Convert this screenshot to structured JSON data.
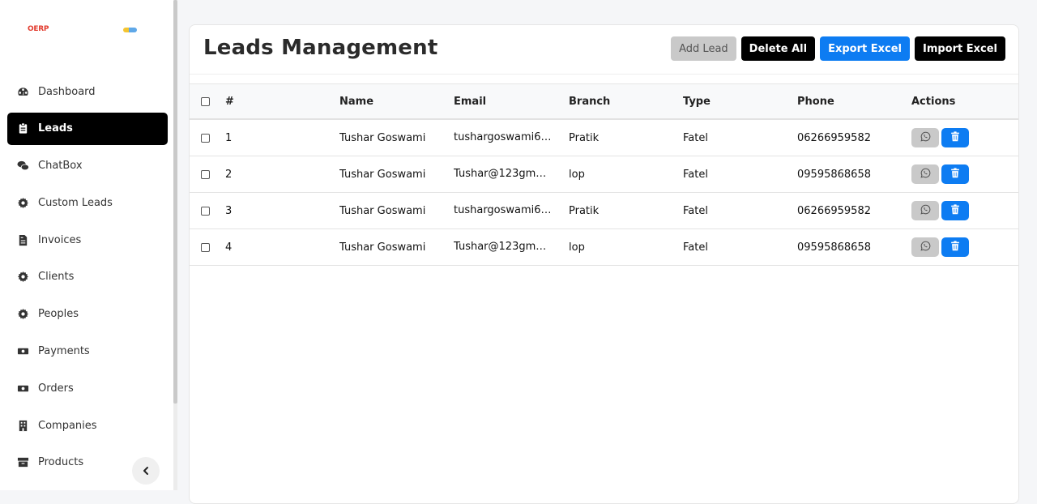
{
  "brand": {
    "logo_text": "OERP"
  },
  "sidebar": {
    "items": [
      {
        "label": "Dashboard",
        "icon": "dashboard-icon",
        "active": false
      },
      {
        "label": "Leads",
        "icon": "clipboard-icon",
        "active": true
      },
      {
        "label": "ChatBox",
        "icon": "chat-icon",
        "active": false
      },
      {
        "label": "Custom Leads",
        "icon": "gear-icon",
        "active": false
      },
      {
        "label": "Invoices",
        "icon": "invoice-icon",
        "active": false
      },
      {
        "label": "Clients",
        "icon": "gear-icon",
        "active": false
      },
      {
        "label": "Peoples",
        "icon": "gear-icon",
        "active": false
      },
      {
        "label": "Payments",
        "icon": "money-icon",
        "active": false
      },
      {
        "label": "Orders",
        "icon": "money-icon",
        "active": false
      },
      {
        "label": "Companies",
        "icon": "building-icon",
        "active": false
      },
      {
        "label": "Products",
        "icon": "box-icon",
        "active": false
      }
    ],
    "collapse_icon": "chevron-left-icon"
  },
  "main": {
    "title": "Leads Management",
    "toolbar": {
      "add_lead": "Add Lead",
      "delete_all": "Delete All",
      "export_excel": "Export Excel",
      "import_excel": "Import Excel"
    },
    "table": {
      "columns": [
        "#",
        "Name",
        "Email",
        "Branch",
        "Type",
        "Phone",
        "Actions"
      ],
      "rows": [
        {
          "num": "1",
          "name": "Tushar Goswami",
          "email": "tushargoswami6…",
          "branch": "Pratik",
          "type": "Fatel",
          "phone": "06266959582"
        },
        {
          "num": "2",
          "name": "Tushar Goswami",
          "email": "Tushar@123gmai…",
          "branch": "lop",
          "type": "Fatel",
          "phone": "09595868658"
        },
        {
          "num": "3",
          "name": "Tushar Goswami",
          "email": "tushargoswami6…",
          "branch": "Pratik",
          "type": "Fatel",
          "phone": "06266959582"
        },
        {
          "num": "4",
          "name": "Tushar Goswami",
          "email": "Tushar@123gmai…",
          "branch": "lop",
          "type": "Fatel",
          "phone": "09595868658"
        }
      ]
    }
  },
  "colors": {
    "accent": "#0d7cf2",
    "active_nav_bg": "#000000",
    "grey_button": "#c9c9c9"
  }
}
